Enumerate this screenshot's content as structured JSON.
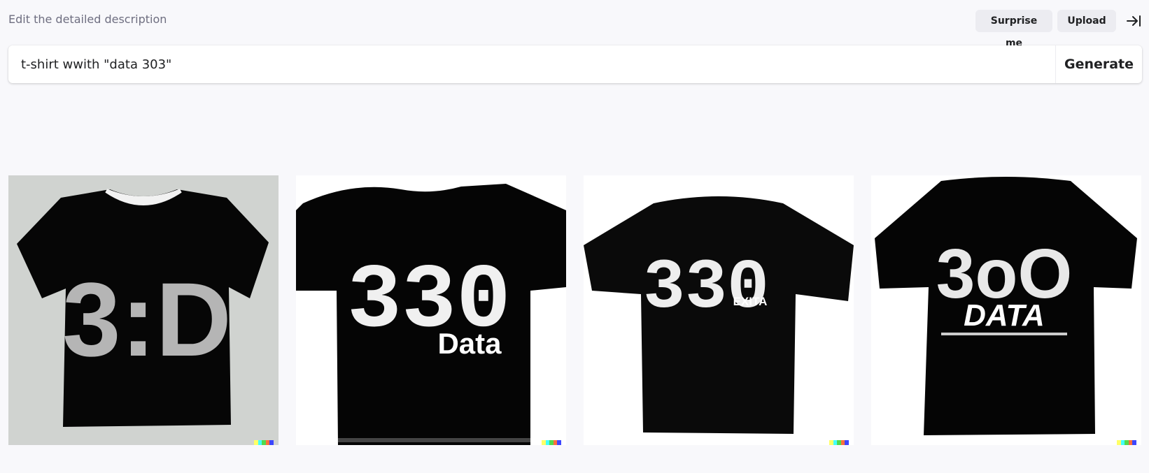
{
  "header": {
    "description_label": "Edit the detailed description",
    "surprise_label": "Surprise me",
    "upload_label": "Upload"
  },
  "prompt": {
    "value": "t-shirt wwith \"data 303\"",
    "generate_label": "Generate"
  },
  "results": [
    {
      "graphic_text": "3:D",
      "caption": ""
    },
    {
      "graphic_text": "330",
      "caption": "Data"
    },
    {
      "graphic_text": "330",
      "caption": "EXITA"
    },
    {
      "graphic_text": "3oO",
      "caption": "DATA"
    }
  ],
  "watermark_colors": [
    "#ffff66",
    "#42ffff",
    "#51da4c",
    "#ff6e3c",
    "#3c46ff"
  ],
  "icons": {
    "collapse": "collapse-right-icon"
  }
}
